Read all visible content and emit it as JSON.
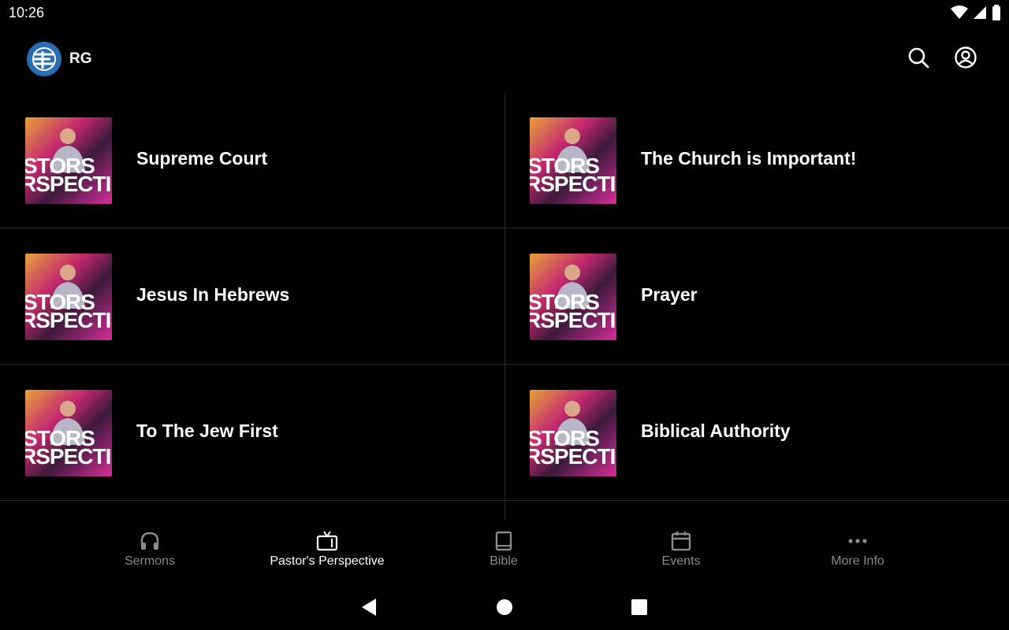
{
  "status_bar": {
    "time": "10:26",
    "icons": [
      "wifi-icon",
      "signal-icon",
      "battery-icon"
    ]
  },
  "app_bar": {
    "logo": "church-logo-icon",
    "title": "RG",
    "actions": [
      "search-icon",
      "account-circle-icon"
    ]
  },
  "thumbnail": {
    "line1": "STORS",
    "line2": "RSPECTI"
  },
  "items": [
    {
      "title": "Supreme Court"
    },
    {
      "title": "The Church is Important!"
    },
    {
      "title": "Jesus In Hebrews"
    },
    {
      "title": "Prayer"
    },
    {
      "title": "To The Jew First"
    },
    {
      "title": "Biblical Authority"
    }
  ],
  "bottom_nav": {
    "items": [
      {
        "label": "Sermons",
        "icon": "headphones-icon",
        "active": false
      },
      {
        "label": "Pastor's Perspective",
        "icon": "tv-icon",
        "active": true
      },
      {
        "label": "Bible",
        "icon": "book-icon",
        "active": false
      },
      {
        "label": "Events",
        "icon": "calendar-icon",
        "active": false
      },
      {
        "label": "More Info",
        "icon": "more-horizontal-icon",
        "active": false
      }
    ]
  },
  "system_nav": [
    "back-icon",
    "home-icon",
    "recents-icon"
  ],
  "colors": {
    "background": "#000000",
    "active_nav": "#ffffff",
    "inactive_nav": "#8a8a8a",
    "logo_blue": "#2a6db5"
  }
}
